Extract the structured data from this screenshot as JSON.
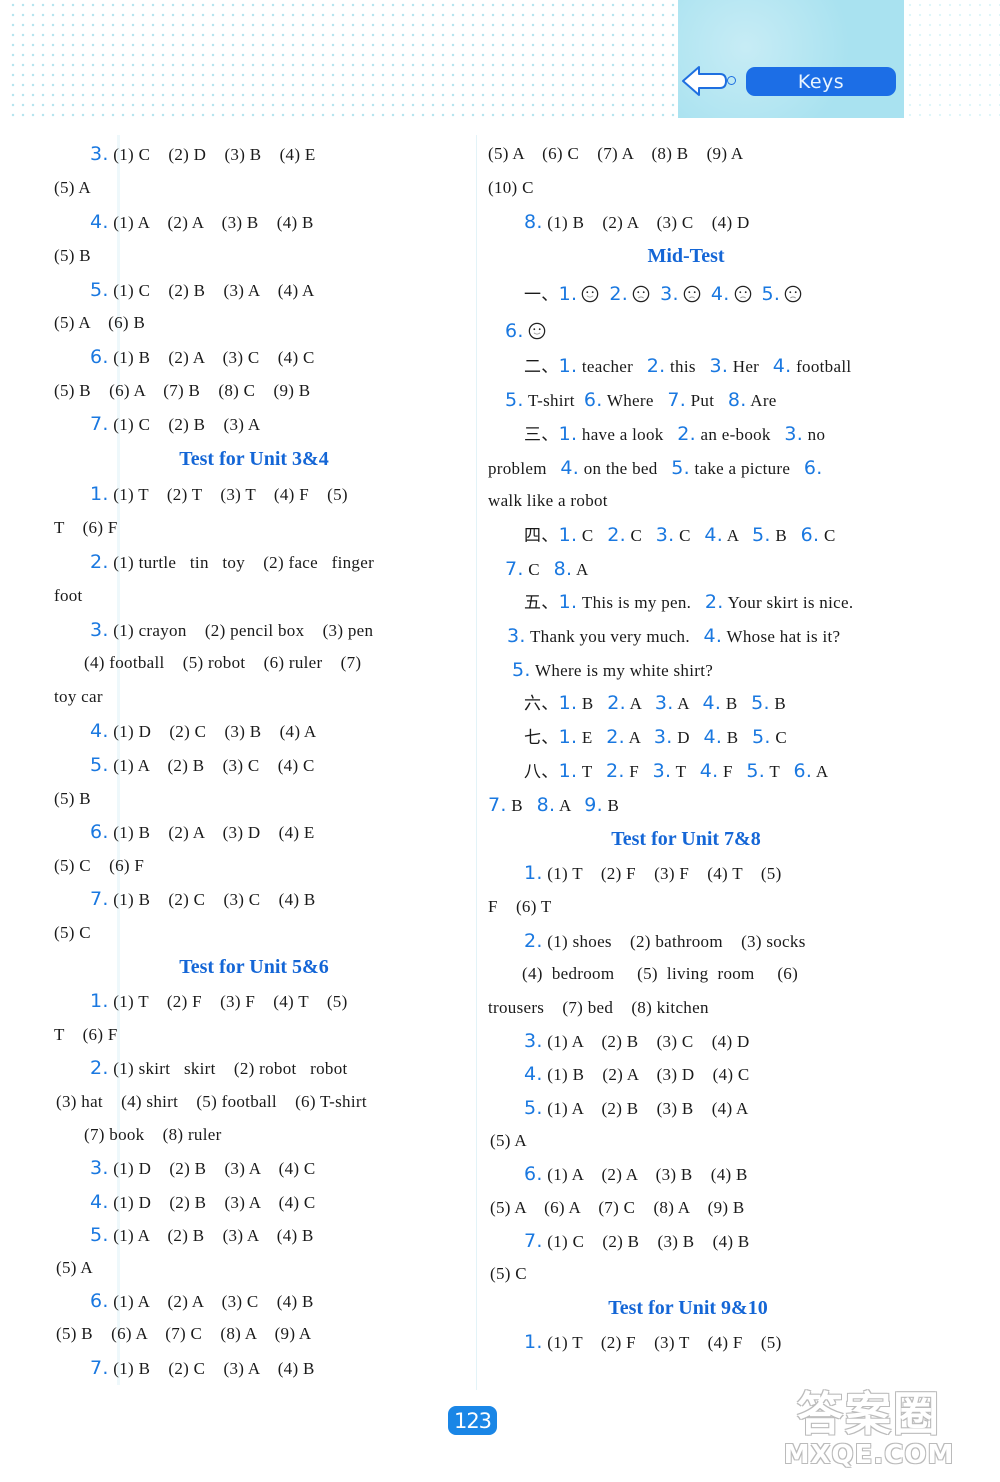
{
  "header": {
    "badge_label": "Keys",
    "back_icon": "back-arrow-icon"
  },
  "left_column": {
    "lines": [
      {
        "num": "3.",
        "text": "(1) C    (2) D    (3) B    (4) E"
      },
      {
        "num": "",
        "text": "(5) A"
      },
      {
        "num": "4.",
        "text": "(1) A    (2) A    (3) B    (4) B"
      },
      {
        "num": "",
        "text": "(5) B"
      },
      {
        "num": "5.",
        "text": "(1) C    (2) B    (3) A    (4) A"
      },
      {
        "num": "",
        "text": "(5) A    (6) B"
      },
      {
        "num": "6.",
        "text": "(1) B    (2) A    (3) C    (4) C"
      },
      {
        "num": "",
        "text": "(5) B    (6) A    (7) B    (8) C    (9) B"
      },
      {
        "num": "7.",
        "text": "(1) C    (2) B    (3) A"
      }
    ],
    "section_unit34": {
      "title": "Test for Unit 3&4",
      "lines": [
        {
          "num": "1.",
          "text": "(1) T    (2) T    (3) T    (4) F    (5)"
        },
        {
          "num": "",
          "text": "T    (6) F"
        },
        {
          "num": "2.",
          "text": "(1) turtle   tin   toy    (2) face   finger"
        },
        {
          "num": "",
          "text": "foot"
        },
        {
          "num": "3.",
          "text": "(1) crayon    (2) pencil box    (3) pen"
        },
        {
          "num": "",
          "text": "(4) football    (5) robot    (6) ruler    (7)"
        },
        {
          "num": "",
          "text": "toy car"
        },
        {
          "num": "4.",
          "text": "(1) D    (2) C    (3) B    (4) A"
        },
        {
          "num": "5.",
          "text": "(1) A    (2) B    (3) C    (4) C"
        },
        {
          "num": "",
          "text": "(5) B"
        },
        {
          "num": "6.",
          "text": "(1) B    (2) A    (3) D    (4) E"
        },
        {
          "num": "",
          "text": "(5) C    (6) F"
        },
        {
          "num": "7.",
          "text": "(1) B    (2) C    (3) C    (4) B"
        },
        {
          "num": "",
          "text": "(5) C"
        }
      ]
    },
    "section_unit56": {
      "title": "Test for Unit 5&6",
      "lines": [
        {
          "num": "1.",
          "text": "(1) T    (2) F    (3) F    (4) T    (5)"
        },
        {
          "num": "",
          "text": "T    (6) F"
        },
        {
          "num": "2.",
          "text": "(1) skirt   skirt    (2) robot   robot"
        },
        {
          "num": "",
          "text": "(3) hat    (4) shirt    (5) football    (6) T-shirt"
        },
        {
          "num": "",
          "text": "(7) book    (8) ruler"
        },
        {
          "num": "3.",
          "text": "(1) D    (2) B    (3) A    (4) C"
        },
        {
          "num": "4.",
          "text": "(1) D    (2) B    (3) A    (4) C"
        },
        {
          "num": "5.",
          "text": "(1) A    (2) B    (3) A    (4) B"
        },
        {
          "num": "",
          "text": "(5) A"
        },
        {
          "num": "6.",
          "text": "(1) A    (2) A    (3) C    (4) B"
        },
        {
          "num": "",
          "text": "(5) B    (6) A    (7) C    (8) A    (9) A"
        },
        {
          "num": "7.",
          "text": "(1) B    (2) C    (3) A    (4) B"
        }
      ]
    }
  },
  "right_column": {
    "top_lines": [
      {
        "num": "",
        "text": "(5) A    (6) C    (7) A    (8) B    (9) A"
      },
      {
        "num": "",
        "text": "(10) C"
      },
      {
        "num": "8.",
        "text": "(1) B    (2) A    (3) C    (4) D"
      }
    ],
    "mid_test": {
      "title": "Mid-Test",
      "part1_label": "一、",
      "part1_faces": [
        {
          "num": "1.",
          "face": "smile"
        },
        {
          "num": "2.",
          "face": "sad"
        },
        {
          "num": "3.",
          "face": "sad"
        },
        {
          "num": "4.",
          "face": "sad"
        },
        {
          "num": "5.",
          "face": "sad"
        },
        {
          "num": "6.",
          "face": "smile"
        }
      ],
      "part2_label": "二、",
      "part2": [
        {
          "num": "1.",
          "text": "teacher"
        },
        {
          "num": "2.",
          "text": "this"
        },
        {
          "num": "3.",
          "text": "Her"
        },
        {
          "num": "4.",
          "text": "football"
        },
        {
          "num": "5.",
          "text": "T-shirt"
        },
        {
          "num": "6.",
          "text": "Where"
        },
        {
          "num": "7.",
          "text": "Put"
        },
        {
          "num": "8.",
          "text": "Are"
        }
      ],
      "part3_label": "三、",
      "part3": [
        {
          "num": "1.",
          "text": "have a look"
        },
        {
          "num": "2.",
          "text": "an e-book"
        },
        {
          "num": "3.",
          "text": "no problem"
        },
        {
          "num": "4.",
          "text": "on the bed"
        },
        {
          "num": "5.",
          "text": "take a picture"
        },
        {
          "num": "6.",
          "text": "walk like a robot"
        }
      ],
      "part4_label": "四、",
      "part4": [
        {
          "num": "1.",
          "text": "C"
        },
        {
          "num": "2.",
          "text": "C"
        },
        {
          "num": "3.",
          "text": "C"
        },
        {
          "num": "4.",
          "text": "A"
        },
        {
          "num": "5.",
          "text": "B"
        },
        {
          "num": "6.",
          "text": "C"
        },
        {
          "num": "7.",
          "text": "C"
        },
        {
          "num": "8.",
          "text": "A"
        }
      ],
      "part5_label": "五、",
      "part5": [
        {
          "num": "1.",
          "text": "This is my pen."
        },
        {
          "num": "2.",
          "text": "Your skirt is nice."
        },
        {
          "num": "3.",
          "text": "Thank you very much."
        },
        {
          "num": "4.",
          "text": "Whose hat is it?"
        },
        {
          "num": "5.",
          "text": "Where is my white shirt?"
        }
      ],
      "part6_label": "六、",
      "part6": [
        {
          "num": "1.",
          "text": "B"
        },
        {
          "num": "2.",
          "text": "A"
        },
        {
          "num": "3.",
          "text": "A"
        },
        {
          "num": "4.",
          "text": "B"
        },
        {
          "num": "5.",
          "text": "B"
        }
      ],
      "part7_label": "七、",
      "part7": [
        {
          "num": "1.",
          "text": "E"
        },
        {
          "num": "2.",
          "text": "A"
        },
        {
          "num": "3.",
          "text": "D"
        },
        {
          "num": "4.",
          "text": "B"
        },
        {
          "num": "5.",
          "text": "C"
        }
      ],
      "part8_label": "八、",
      "part8": [
        {
          "num": "1.",
          "text": "T"
        },
        {
          "num": "2.",
          "text": "F"
        },
        {
          "num": "3.",
          "text": "T"
        },
        {
          "num": "4.",
          "text": "F"
        },
        {
          "num": "5.",
          "text": "T"
        },
        {
          "num": "6.",
          "text": "A"
        },
        {
          "num": "7.",
          "text": "B"
        },
        {
          "num": "8.",
          "text": "A"
        },
        {
          "num": "9.",
          "text": "B"
        }
      ]
    },
    "section_unit78": {
      "title": "Test for Unit 7&8",
      "lines": [
        {
          "num": "1.",
          "text": "(1) T    (2) F    (3) F    (4) T    (5)"
        },
        {
          "num": "",
          "text": "F    (6) T"
        },
        {
          "num": "2.",
          "text": "(1) shoes    (2) bathroom    (3) socks"
        },
        {
          "num": "",
          "text": "(4)  bedroom     (5)  living  room     (6)"
        },
        {
          "num": "",
          "text": "trousers    (7) bed    (8) kitchen"
        },
        {
          "num": "3.",
          "text": "(1) A    (2) B    (3) C    (4) D"
        },
        {
          "num": "4.",
          "text": "(1) B    (2) A    (3) D    (4) C"
        },
        {
          "num": "5.",
          "text": "(1) A    (2) B    (3) B    (4) A"
        },
        {
          "num": "",
          "text": "(5) A"
        },
        {
          "num": "6.",
          "text": "(1) A    (2) A    (3) B    (4) B"
        },
        {
          "num": "",
          "text": "(5) A    (6) A    (7) C    (8) A    (9) B"
        },
        {
          "num": "7.",
          "text": "(1) C    (2) B    (3) B    (4) B"
        },
        {
          "num": "",
          "text": "(5) C"
        }
      ]
    },
    "section_unit910": {
      "title": "Test for Unit 9&10",
      "lines": [
        {
          "num": "1.",
          "text": "(1) T    (2) F    (3) T    (4) F    (5)"
        }
      ]
    }
  },
  "footer": {
    "page_number": "123",
    "watermark_top": "答案圈",
    "watermark_bottom": "MXQE.COM"
  },
  "colors": {
    "accent_blue": "#1a78e0",
    "heading_blue": "#1466d6",
    "header_panel": "#a9e2f0",
    "badge_blue": "#1c6ee6"
  }
}
